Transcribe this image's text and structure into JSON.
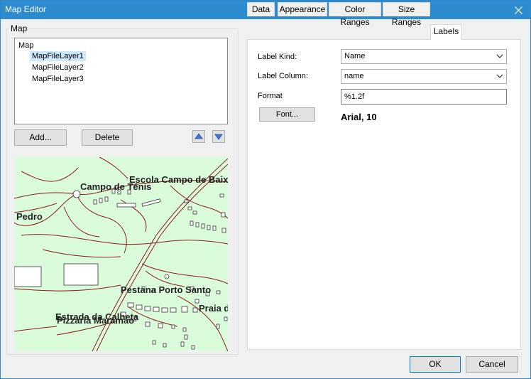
{
  "window": {
    "title": "Map Editor"
  },
  "group": {
    "label": "Map"
  },
  "tree": {
    "root": "Map",
    "layers": [
      "MapFileLayer1",
      "MapFileLayer2",
      "MapFileLayer3"
    ],
    "selected_index": 0
  },
  "buttons": {
    "add": "Add...",
    "delete": "Delete",
    "font": "Font...",
    "ok": "OK",
    "cancel": "Cancel"
  },
  "map_labels": [
    "Escola Campo de Baixo",
    "Campo de Ténis",
    "Pedro",
    "Pestana Porto Santo",
    "Praia d",
    "Estrada da Calheta",
    "Pizzaria Maramao"
  ],
  "tabs": [
    "Data",
    "Appearance",
    "Color Ranges",
    "Size Ranges",
    "Labels"
  ],
  "active_tab": "Labels",
  "labels_panel": {
    "label_kind_label": "Label Kind:",
    "label_kind_value": "Name",
    "label_column_label": "Label Column:",
    "label_column_value": "name",
    "format_label": "Format",
    "format_value": "%1.2f",
    "font_value": "Arial, 10"
  },
  "icons": {
    "close": "close-icon",
    "up": "arrow-up-icon",
    "down": "arrow-down-icon",
    "dropdown": "chevron-down-icon"
  },
  "colors": {
    "titlebar": "#2d8bd0",
    "map_background": "#dbfcdb",
    "map_roads": "#8b1a1a",
    "selection": "#cce8ff"
  }
}
